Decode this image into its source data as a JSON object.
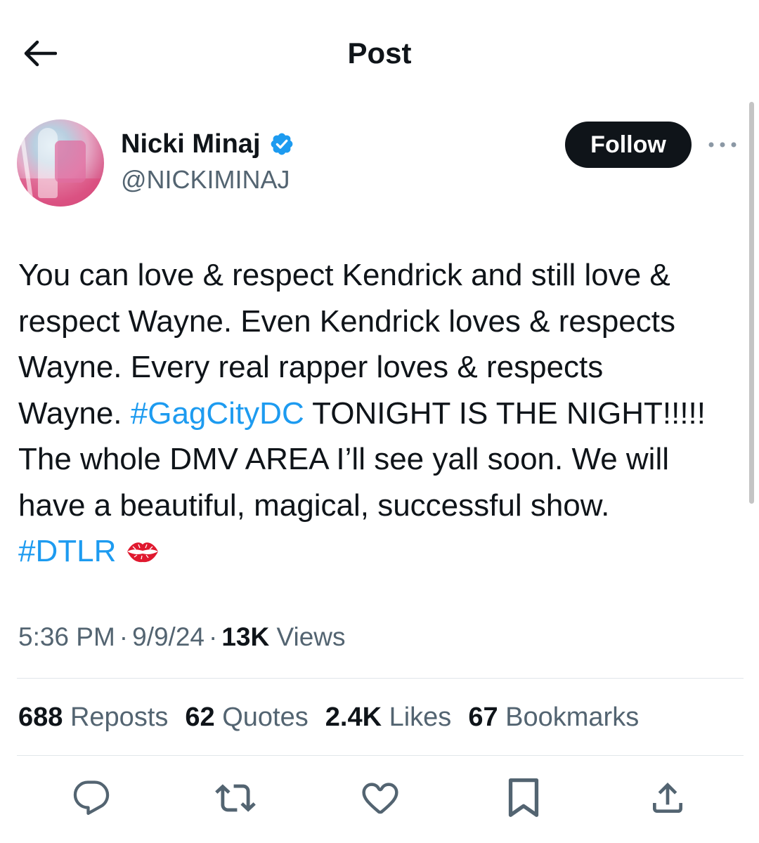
{
  "header": {
    "back_icon": "arrow-left-icon",
    "title": "Post"
  },
  "author": {
    "display_name": "Nicki Minaj",
    "handle": "@NICKIMINAJ",
    "verified": true,
    "verified_color": "#1d9bf0",
    "follow_label": "Follow",
    "more_icon": "more-horizontal-icon"
  },
  "post": {
    "lines": [
      [
        {
          "text": "You can love & respect Kendrick and still love &",
          "type": "text"
        }
      ],
      [
        {
          "text": "respect Wayne. Even Kendrick loves & respects",
          "type": "text"
        }
      ],
      [
        {
          "text": "Wayne. Every real rapper loves & respects",
          "type": "text"
        }
      ],
      [
        {
          "text": "Wayne. ",
          "type": "text"
        },
        {
          "text": "#GagCityDC",
          "type": "hashtag"
        },
        {
          "text": " TONIGHT IS THE NIGHT!!!!!",
          "type": "text"
        }
      ],
      [
        {
          "text": "The whole DMV AREA I’ll see yall soon. We will",
          "type": "text"
        }
      ],
      [
        {
          "text": "have a beautiful, magical, successful show.",
          "type": "text"
        }
      ],
      [
        {
          "text": "#DTLR",
          "type": "hashtag"
        },
        {
          "text": "kiss-mark-emoji",
          "type": "emoji"
        }
      ]
    ],
    "hashtag_color": "#1d9bf0"
  },
  "meta": {
    "time": "5:36 PM",
    "date": "9/9/24",
    "views_count": "13K",
    "views_label": "Views",
    "separator": "·"
  },
  "stats": [
    {
      "count": "688",
      "label": "Reposts"
    },
    {
      "count": "62",
      "label": "Quotes"
    },
    {
      "count": "2.4K",
      "label": "Likes"
    },
    {
      "count": "67",
      "label": "Bookmarks"
    }
  ],
  "actions": [
    {
      "icon": "reply-icon"
    },
    {
      "icon": "repost-icon"
    },
    {
      "icon": "like-icon"
    },
    {
      "icon": "bookmark-icon"
    },
    {
      "icon": "share-icon"
    }
  ]
}
